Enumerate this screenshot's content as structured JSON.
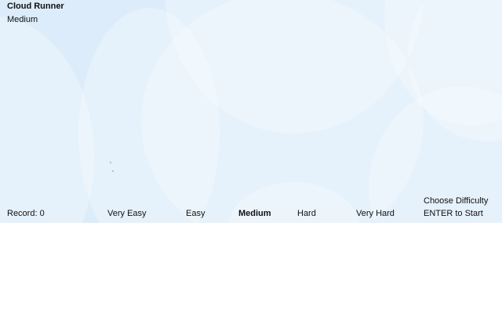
{
  "game": {
    "title": "Cloud Runner",
    "current_difficulty": "Medium",
    "record_label": "Record: 0",
    "difficulty_options": [
      "Very Easy",
      "Easy",
      "Medium",
      "Hard",
      "Very Hard"
    ],
    "selected_option": "Medium",
    "instructions": {
      "line1": "Choose Difficulty",
      "line2": "ENTER to Start"
    }
  },
  "colors": {
    "sky": "#dcecfa",
    "bubble": "rgba(255,255,255,0.28)"
  }
}
